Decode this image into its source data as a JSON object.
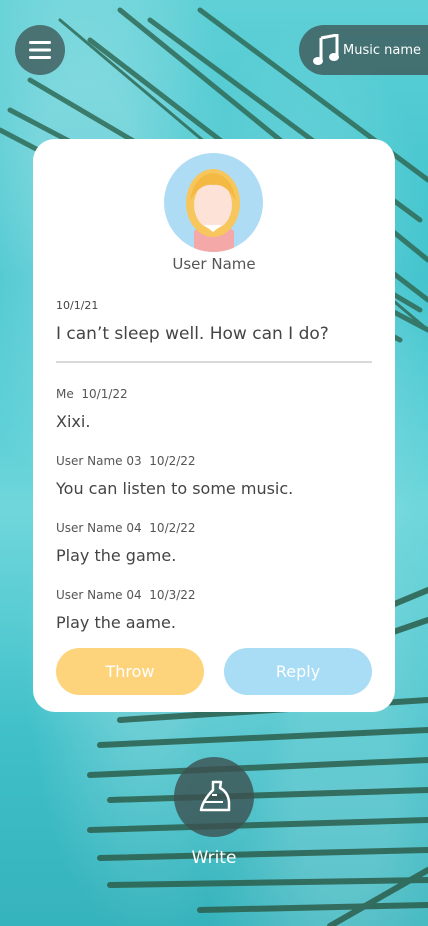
{
  "header": {
    "menu_icon": "hamburger-menu-icon",
    "music_icon": "music-note-icon",
    "music_name": "Music name"
  },
  "post": {
    "user_name": "User Name",
    "date": "10/1/21",
    "text": "I can’t sleep well. How can I do?"
  },
  "replies": [
    {
      "author": "Me",
      "date": "10/1/22",
      "text": "Xixi."
    },
    {
      "author": "User Name 03",
      "date": "10/2/22",
      "text": "You can listen to some music."
    },
    {
      "author": "User Name 04",
      "date": "10/2/22",
      "text": "Play the game."
    },
    {
      "author": "User Name 04",
      "date": "10/3/22",
      "text": "Play the aame."
    }
  ],
  "actions": {
    "throw_label": "Throw",
    "reply_label": "Reply"
  },
  "write": {
    "icon": "bottle-icon",
    "label": "Write"
  },
  "colors": {
    "throw": "#fdd47c",
    "reply": "#a9dcf5",
    "avatar_bg": "#aedcf5"
  }
}
